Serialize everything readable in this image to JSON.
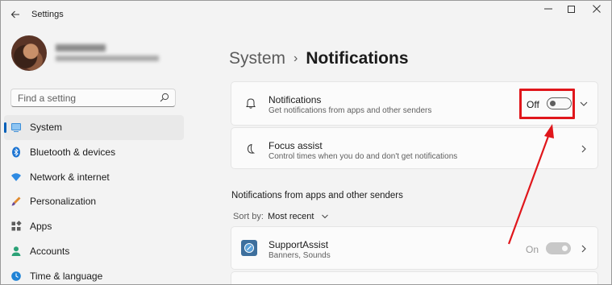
{
  "window": {
    "app_title": "Settings"
  },
  "search": {
    "placeholder": "Find a setting"
  },
  "sidebar": {
    "items": [
      {
        "label": "System",
        "icon": "system-icon",
        "active": true
      },
      {
        "label": "Bluetooth & devices",
        "icon": "bluetooth-icon"
      },
      {
        "label": "Network & internet",
        "icon": "network-icon"
      },
      {
        "label": "Personalization",
        "icon": "personalization-icon"
      },
      {
        "label": "Apps",
        "icon": "apps-icon"
      },
      {
        "label": "Accounts",
        "icon": "accounts-icon"
      },
      {
        "label": "Time & language",
        "icon": "time-language-icon"
      }
    ]
  },
  "breadcrumb": {
    "parent": "System",
    "separator": "›",
    "current": "Notifications"
  },
  "notifications_card": {
    "title": "Notifications",
    "subtitle": "Get notifications from apps and other senders",
    "toggle_state": "Off",
    "toggle_on": false
  },
  "focus_card": {
    "title": "Focus assist",
    "subtitle": "Control times when you do and don't get notifications"
  },
  "apps_section": {
    "title": "Notifications from apps and other senders",
    "sort_label": "Sort by:",
    "sort_value": "Most recent",
    "apps": [
      {
        "name": "SupportAssist",
        "detail": "Banners, Sounds",
        "toggle_state": "On",
        "toggle_on": true,
        "enabled": false
      }
    ]
  },
  "colors": {
    "accent": "#005fb8",
    "annotation": "#e0161b",
    "background": "#f3f3f3",
    "card": "#fbfbfb"
  }
}
